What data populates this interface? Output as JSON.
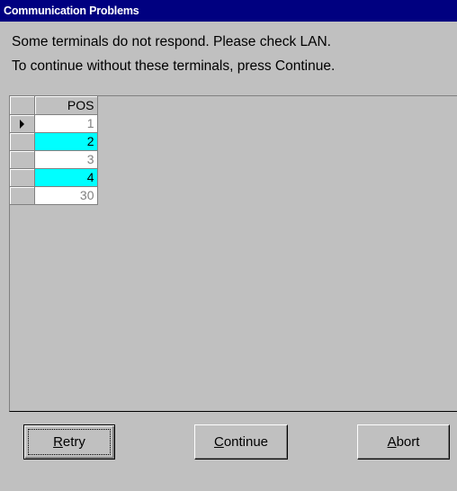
{
  "dialog": {
    "title": "Communication Problems",
    "message_line1": "Some terminals do not respond. Please check LAN.",
    "message_line2": "To continue without these terminals, press Continue."
  },
  "grid": {
    "column_header": "POS",
    "current_row_indicator": "arrow-right-icon",
    "rows": [
      {
        "value": "1",
        "highlighted": false
      },
      {
        "value": "2",
        "highlighted": true
      },
      {
        "value": "3",
        "highlighted": false
      },
      {
        "value": "4",
        "highlighted": true
      },
      {
        "value": "30",
        "highlighted": false
      }
    ],
    "highlight_color": "#00ffff"
  },
  "buttons": {
    "retry_prefix": "R",
    "retry_rest": "etry",
    "continue_prefix": "C",
    "continue_rest": "ontinue",
    "abort_prefix": "A",
    "abort_rest": "bort"
  },
  "colors": {
    "titlebar": "#000080",
    "dialog_bg": "#c0c0c0"
  }
}
